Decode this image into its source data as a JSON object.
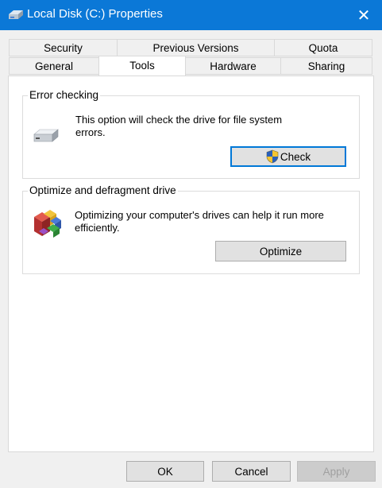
{
  "window": {
    "title": "Local Disk (C:) Properties",
    "close_glyph": "✕"
  },
  "tabs": {
    "row1": [
      "Security",
      "Previous Versions",
      "Quota"
    ],
    "row2": [
      "General",
      "Tools",
      "Hardware",
      "Sharing"
    ],
    "active": "Tools"
  },
  "error_checking": {
    "title": "Error checking",
    "description": "This option will check the drive for file system errors.",
    "button": "Check"
  },
  "optimize": {
    "title": "Optimize and defragment drive",
    "description": "Optimizing your computer's drives can help it run more efficiently.",
    "button": "Optimize"
  },
  "footer": {
    "ok": "OK",
    "cancel": "Cancel",
    "apply": "Apply"
  },
  "colors": {
    "titlebar": "#0b78d7",
    "accent_border": "#0078d7"
  }
}
